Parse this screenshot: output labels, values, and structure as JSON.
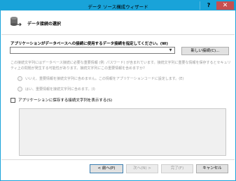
{
  "window": {
    "title": "データ ソース構成ウィザード",
    "help_label": "?",
    "close_label": "✕"
  },
  "header": {
    "title": "データ接続の選択",
    "icon": "database-connection-icon"
  },
  "connection": {
    "question": "アプリケーションがデータベースへの接続に使用するデータ接続を指定してください。(W)",
    "combo_value": "",
    "combo_arrow": "▼",
    "new_connection_label": "新しい接続(C)..."
  },
  "sensitive": {
    "info": "この接続文字列にはデータベース接続に必要な重要情報 (例: パスワード) が含まれています。接続文字列に重要な情報を保存するとセキュリティ上の問題が発生する可能性があります。接続文字列にこの重要情報を含めますか?",
    "option_no": "いいえ、重要情報を接続文字列に含めません。この情報をアプリケーションコードに設定します。(E)",
    "option_yes": "はい、重要情報を接続文字列に含めます。(I)"
  },
  "show_string": {
    "label": "アプリケーションに保存する接続文字列を表示する(S)",
    "checked": false
  },
  "footer": {
    "back_label": "< 前へ(P)",
    "next_label": "次へ(N) >",
    "finish_label": "完了(F)",
    "cancel_label": "キャンセル"
  }
}
